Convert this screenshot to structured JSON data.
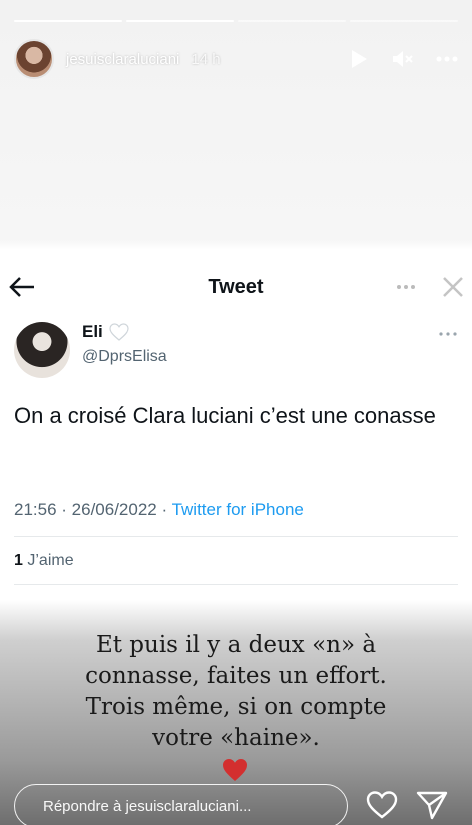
{
  "story": {
    "progress": [
      1,
      1,
      0,
      0
    ],
    "username": "jesuisclaraluciani",
    "time_ago": "14 h",
    "icons": [
      "play-icon",
      "mute-icon",
      "more-icon"
    ]
  },
  "tweet": {
    "header_title": "Tweet",
    "author_name": "Eli",
    "author_handle": "@DprsElisa",
    "text": "On a croisé Clara luciani c’est une conasse",
    "time": "21:56",
    "date": "26/06/2022",
    "source": "Twitter for iPhone",
    "likes_count": "1",
    "likes_label": "J’aime"
  },
  "caption": {
    "line1": "Et puis il y a deux «n» à",
    "line2": "connasse, faites un effort.",
    "line3": "Trois même, si on compte",
    "line4": "votre «haine»."
  },
  "reply": {
    "placeholder": "Répondre à jesuisclaraluciani..."
  },
  "colors": {
    "twitter_blue": "#1d9bf0",
    "heart_red": "#d32f2f"
  }
}
